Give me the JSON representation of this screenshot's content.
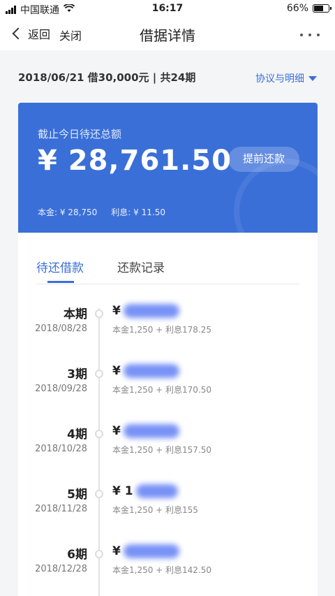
{
  "status_bar": {
    "carrier": "中国联通",
    "time": "16:17",
    "battery_text": "66%",
    "battery_level": 0.66
  },
  "nav": {
    "back_label": "返回",
    "close_label": "关闭",
    "title": "借据详情"
  },
  "summary": {
    "text": "2018/06/21 借30,000元 | 共24期",
    "protocol_label": "协议与明细"
  },
  "card": {
    "label": "截止今日待还总额",
    "amount": "¥ 28,761.50",
    "prepay_label": "提前还款",
    "principal": "本金: ¥ 28,750",
    "interest": "利息: ¥ 11.50"
  },
  "tabs": {
    "active": "待还借款",
    "inactive": "还款记录"
  },
  "schedule": [
    {
      "period": "本期",
      "date": "2018/08/28",
      "currency": "¥",
      "breakdown": "本金1,250 + 利息178.25"
    },
    {
      "period": "3期",
      "date": "2018/09/28",
      "currency": "¥",
      "breakdown": "本金1,250 + 利息170.50"
    },
    {
      "period": "4期",
      "date": "2018/10/28",
      "currency": "¥",
      "breakdown": "本金1,250 + 利息157.50"
    },
    {
      "period": "5期",
      "date": "2018/11/28",
      "currency": "¥ 1",
      "breakdown": "本金1,250 + 利息155"
    },
    {
      "period": "6期",
      "date": "2018/12/28",
      "currency": "¥",
      "breakdown": "本金1,250 + 利息142.50"
    }
  ],
  "colors": {
    "accent": "#3a6fd8",
    "background": "#f4f5f7"
  },
  "icons": [
    "signal-icon",
    "wifi-icon",
    "battery-icon",
    "back-chevron-icon",
    "more-icon",
    "dropdown-triangle-icon"
  ]
}
